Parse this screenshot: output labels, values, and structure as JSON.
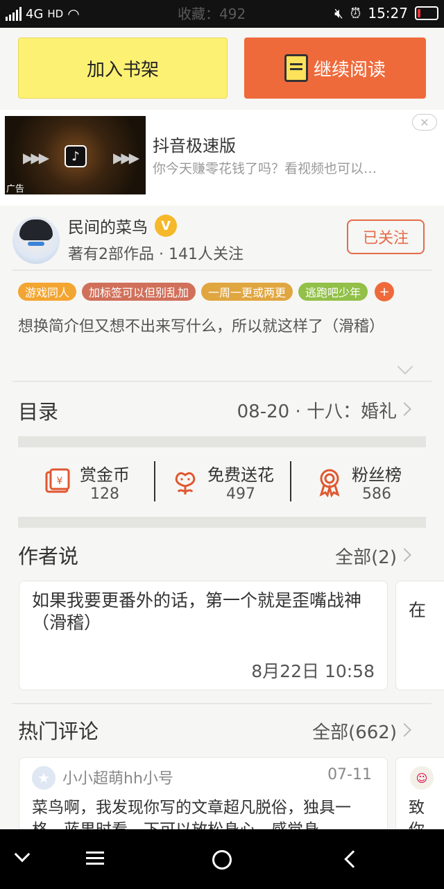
{
  "status_bar": {
    "network": "4G",
    "hd": "HD",
    "ghost_text": "收藏：492",
    "time": "15:27"
  },
  "actions": {
    "add_shelf": "加入书架",
    "continue_reading": "继续阅读"
  },
  "ad": {
    "title": "抖音极速版",
    "description": "你今天赚零花钱了吗？看视频也可以…",
    "badge": "广告",
    "close": "✕",
    "logo": "♪"
  },
  "author": {
    "name": "民间的菜鸟",
    "verified": "V",
    "meta": "著有2部作品 · 141人关注",
    "follow_button": "已关注"
  },
  "tags": [
    {
      "label": "游戏同人",
      "color": "#f3a531"
    },
    {
      "label": "加标签可以但别乱加",
      "color": "#d0705a"
    },
    {
      "label": "一周一更或两更",
      "color": "#e0a640"
    },
    {
      "label": "逃跑吧少年",
      "color": "#92c048"
    }
  ],
  "tag_more": "+",
  "intro": "想换简介但又想不出来写什么，所以就这样了（滑稽）",
  "catalog": {
    "title": "目录",
    "latest": "08-20 · 十八：婚礼"
  },
  "stats": [
    {
      "label": "赏金币",
      "value": "128",
      "icon": "red-envelope-icon"
    },
    {
      "label": "免费送花",
      "value": "497",
      "icon": "flower-icon"
    },
    {
      "label": "粉丝榜",
      "value": "586",
      "icon": "medal-icon"
    }
  ],
  "author_says": {
    "title": "作者说",
    "all": "全部(2)",
    "card_text": "如果我要更番外的话，第一个就是歪嘴战神（滑稽）",
    "card_time": "8月22日 10:58",
    "next_card_text": "在"
  },
  "hot_comments": {
    "title": "热门评论",
    "all": "全部(662)",
    "user": "小小超萌hh小号",
    "date": "07-11",
    "text": "菜鸟啊，我发现你写的文章超凡脱俗，独具一格，蓝果时看，下可以放松身心，感觉身",
    "next_card_text": "致你"
  },
  "colors": {
    "accent": "#ef6a3b",
    "shelf_yellow": "#fdf173",
    "follow_border": "#e46b48"
  }
}
